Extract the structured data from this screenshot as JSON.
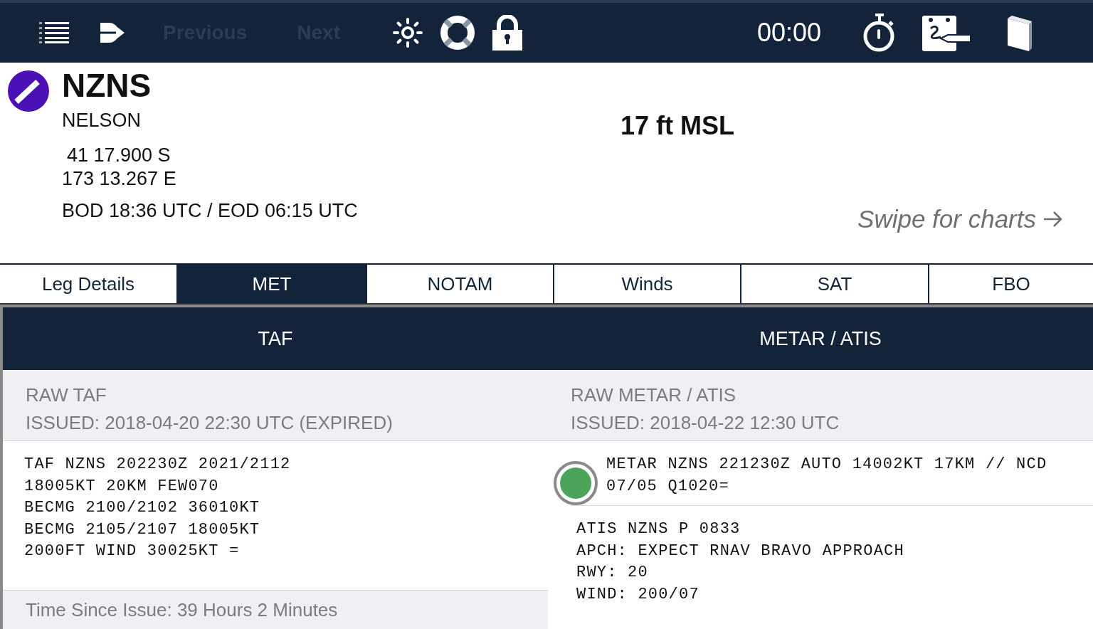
{
  "toolbar": {
    "nav_buttons": [
      {
        "label": "Previous",
        "disabled": true
      },
      {
        "label": "Next",
        "disabled": true
      }
    ],
    "timer": "00:00"
  },
  "airport": {
    "code": "NZNS",
    "name": "NELSON",
    "latitude": "41 17.900 S",
    "longitude": "173 13.267 E",
    "daylight": "BOD 18:36 UTC / EOD 06:15 UTC",
    "elevation": "17 ft MSL",
    "swipe_hint": "Swipe for charts"
  },
  "tabs": [
    {
      "label": "Leg Details",
      "selected": false
    },
    {
      "label": "MET",
      "selected": true
    },
    {
      "label": "NOTAM",
      "selected": false
    },
    {
      "label": "Winds",
      "selected": false
    },
    {
      "label": "SAT",
      "selected": false
    },
    {
      "label": "FBO",
      "selected": false
    }
  ],
  "panels": [
    {
      "title": "TAF",
      "subtitle": "RAW TAF",
      "issued": "ISSUED: 2018-04-20 22:30 UTC (EXPIRED)",
      "reports": [
        {
          "text": "TAF NZNS 202230Z 2021/2112\n18005KT 20KM FEW070\nBECMG 2100/2102 36010KT\nBECMG 2105/2107 18005KT\n2000FT WIND 30025KT ="
        }
      ],
      "footer": "Time Since Issue: 39 Hours 2 Minutes"
    },
    {
      "title": "METAR / ATIS",
      "subtitle": "RAW METAR / ATIS",
      "issued": "ISSUED: 2018-04-22 12:30 UTC",
      "reports": [
        {
          "text": "METAR NZNS 221230Z AUTO 14002KT 17KM // NCD\n07/05 Q1020=",
          "color": "#4aa55a"
        },
        {
          "text": "ATIS NZNS P 0833\nAPCH: EXPECT RNAV BRAVO APPROACH\nRWY: 20\nWIND: 200/07"
        }
      ]
    }
  ]
}
